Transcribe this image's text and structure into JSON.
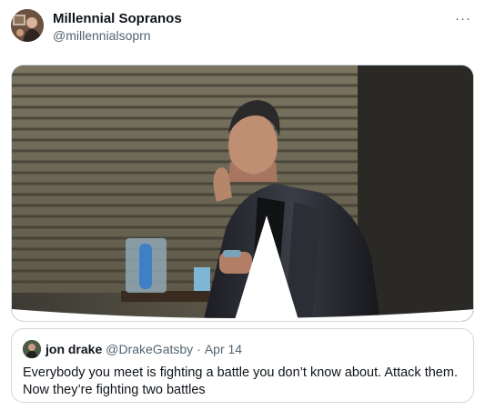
{
  "tweet": {
    "author_name": "Millennial Sopranos",
    "author_handle": "@millennialsoprn",
    "more_label": "···"
  },
  "quoted_tweet": {
    "author_name": "jon drake",
    "author_handle": "@DrakeGatsby",
    "separator": "·",
    "date": "Apr 14",
    "text_line1": "Everybody you meet is fighting a battle you don’t know about. Attack them.",
    "text_line2": "Now they’re fighting two battles"
  },
  "colors": {
    "text_primary": "#0f1419",
    "text_secondary": "#536471",
    "border": "#cfd9de"
  }
}
